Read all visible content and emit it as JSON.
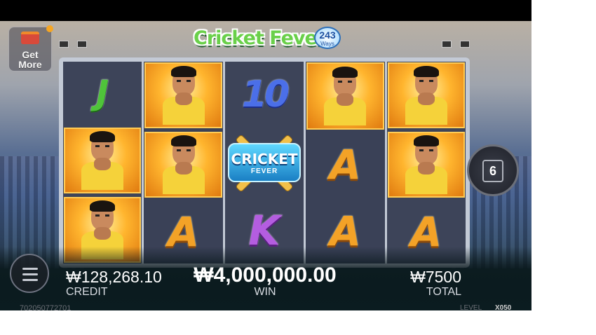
{
  "logo": {
    "title": "Cricket Fever",
    "badge_number": "243",
    "badge_label": "Ways"
  },
  "get_more": {
    "label": "Get More"
  },
  "reels": [
    [
      {
        "symbol": "J"
      },
      {
        "symbol": "player"
      },
      {
        "symbol": "player"
      }
    ],
    [
      {
        "symbol": "player"
      },
      {
        "symbol": "player"
      },
      {
        "symbol": "A"
      }
    ],
    [
      {
        "symbol": "10"
      },
      {
        "symbol": "scatter"
      },
      {
        "symbol": "K"
      }
    ],
    [
      {
        "symbol": "player"
      },
      {
        "symbol": "A"
      },
      {
        "symbol": "A"
      }
    ],
    [
      {
        "symbol": "player"
      },
      {
        "symbol": "player"
      },
      {
        "symbol": "A"
      }
    ]
  ],
  "scatter_text": {
    "line1": "CRICKET",
    "line2": "FEVER"
  },
  "spin_button": {
    "value": "6"
  },
  "credit": {
    "value": "₩128,268.10",
    "label": "CREDIT"
  },
  "win": {
    "value": "₩4,000,000.00",
    "label": "WIN"
  },
  "total": {
    "value": "₩7500",
    "label": "TOTAL"
  },
  "footer": {
    "session_id": "702050772701",
    "level_label": "LEVEL",
    "level_value": "X050"
  },
  "icons": {
    "menu": "hamburger-menu-icon",
    "gift": "gift-icon",
    "notification": "notification-dot"
  },
  "colors": {
    "accent_gold": "#f3a227",
    "win_text": "#ffffff",
    "panel_bg": "#0b1c20"
  }
}
